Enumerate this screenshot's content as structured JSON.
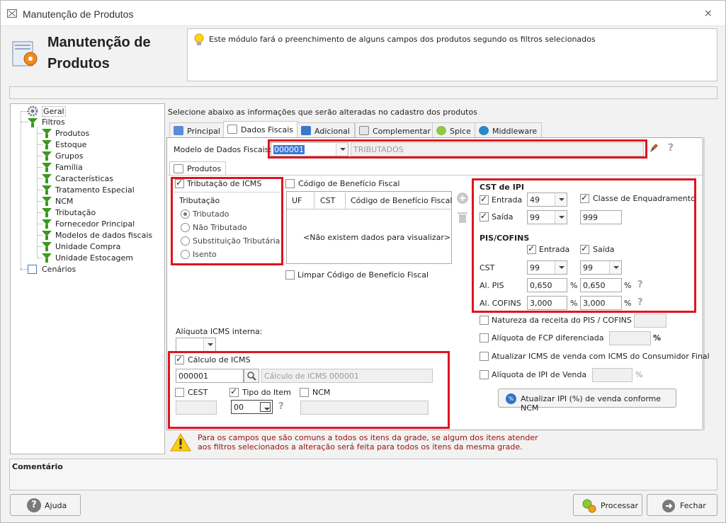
{
  "window": {
    "title": "Manutenção de Produtos",
    "close": "⨯"
  },
  "header": {
    "title_line1": "Manutenção de",
    "title_line2": "Produtos",
    "info": "Este módulo fará o preenchimento de alguns campos dos produtos segundo os filtros selecionados"
  },
  "tree": {
    "root": "Geral",
    "filters": "Filtros",
    "items": [
      "Produtos",
      "Estoque",
      "Grupos",
      "Família",
      "Características",
      "Tratamento Especial",
      "NCM",
      "Tributação",
      "Fornecedor Principal",
      "Modelos de dados fiscais",
      "Unidade Compra",
      "Unidade Estocagem"
    ],
    "scenarios": "Cenários"
  },
  "main": {
    "instruction": "Selecione abaixo as informações que serão alteradas no cadastro dos produtos"
  },
  "tabs": [
    "Principal",
    "Dados Fiscais",
    "Adicional",
    "Complementar",
    "Spice",
    "Middleware"
  ],
  "fiscal": {
    "model_label": "Modelo de Dados Fiscais:",
    "model_code": "000001",
    "model_desc": "TRIBUTADOS",
    "help": "?"
  },
  "subtab": {
    "label": "Produtos"
  },
  "icms": {
    "label": "Tributação de ICMS",
    "group": "Tributação",
    "options": [
      "Tributado",
      "Não Tributado",
      "Substituição Tributária",
      "Isento"
    ]
  },
  "beneficio": {
    "label": "Código de Benefício Fiscal",
    "cols": [
      "UF",
      "CST",
      "Código de Benefício Fiscal"
    ],
    "empty": "<Não existem dados para visualizar>",
    "clear_label": "Limpar Código de Benefício Fiscal"
  },
  "ipi": {
    "title": "CST de IPI",
    "entrada_label": "Entrada",
    "entrada_value": "49",
    "saida_label": "Saída",
    "saida_value": "99",
    "enquadramento_label": "Classe de Enquadramento",
    "enquadramento_value": "999"
  },
  "pis": {
    "title": "PIS/COFINS",
    "entrada_label": "Entrada",
    "saida_label": "Saída",
    "cst_label": "CST",
    "cst_entrada": "99",
    "cst_saida": "99",
    "al_pis_label": "Al. PIS",
    "al_pis_entrada": "0,650",
    "al_pis_saida": "0,650",
    "al_cofins_label": "Al. COFINS",
    "al_cofins_entrada": "3,000",
    "al_cofins_saida": "3,000",
    "pct": "%"
  },
  "extra": {
    "natureza": "Natureza da receita do PIS / COFINS",
    "fcp": "Alíquota de FCP diferenciada",
    "atualizar_icms": "Atualizar ICMS de venda com ICMS do Consumidor Final",
    "ipi_venda": "Alíquota de IPI de Venda",
    "btn_ipi": "Atualizar IPI (%) de venda conforme NCM",
    "pct": "%"
  },
  "icms_interna": {
    "label": "Alíquota ICMS interna:"
  },
  "calculo": {
    "label": "Cálculo de ICMS",
    "code": "000001",
    "desc": "Cálculo de ICMS 000001",
    "cest": "CEST",
    "tipo_item": "Tipo do Item",
    "tipo_value": "00",
    "ncm": "NCM"
  },
  "warning": {
    "line1": "Para os campos que são comuns a todos os itens da grade, se algum dos itens atender",
    "line2": "aos filtros selecionados a alteração será feita para todos os itens da mesma grade."
  },
  "comment": {
    "label": "Comentário"
  },
  "footer": {
    "help": "Ajuda",
    "process": "Processar",
    "close": "Fechar"
  }
}
